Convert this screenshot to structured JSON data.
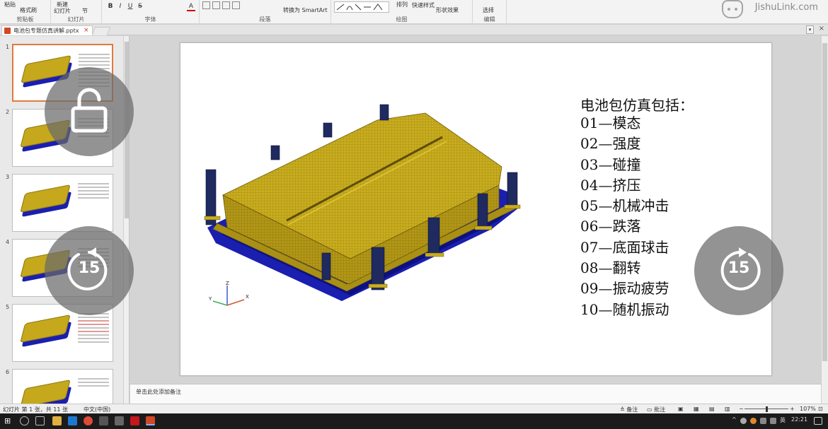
{
  "ribbon": {
    "clipboard": {
      "paste": "粘贴",
      "format_painter": "格式刷",
      "group_label": "剪贴板"
    },
    "slides": {
      "new_slide": "新建",
      "new_slide_sub": "幻灯片",
      "section": "节",
      "group_label": "幻灯片"
    },
    "font": {
      "bold": "B",
      "italic": "I",
      "underline": "U",
      "strike": "S",
      "font_color": "A",
      "group_label": "字体"
    },
    "paragraph": {
      "smartart": "转换为 SmartArt",
      "group_label": "段落"
    },
    "drawing": {
      "arrange": "排列",
      "quick_styles": "快速样式",
      "shape_effects": "形状效果",
      "group_label": "绘图"
    },
    "editing": {
      "select": "选择",
      "group_label": "编辑"
    }
  },
  "watermark": {
    "text": "JishuLink.com"
  },
  "tabs": {
    "doc_tab": "电池包专题仿真讲解.pptx",
    "close_glyph": "×"
  },
  "thumbnails": {
    "numbers": [
      "1",
      "2",
      "3",
      "4",
      "5",
      "6"
    ],
    "selected_index": 0
  },
  "slide": {
    "title": "电池包仿真包括：",
    "items": [
      "01—模态",
      "02—强度",
      "03—碰撞",
      "04—挤压",
      "05—机械冲击",
      "06—跌落",
      "07—底面球击",
      "08—翻转",
      "09—振动疲劳",
      "10—随机振动"
    ],
    "axis": {
      "z": "Z",
      "y": "Y",
      "x": "X"
    }
  },
  "notes": {
    "placeholder": "单击此处添加备注"
  },
  "status": {
    "slide_info": "幻灯片 第 1 张，共 11 张",
    "language": "中文(中国)",
    "notes_btn": "备注",
    "comments_btn": "批注",
    "zoom": "107%"
  },
  "overlays": {
    "skip_back_label": "15",
    "skip_forward_label": "15"
  },
  "taskbar": {
    "ime": "英",
    "clock": "22:21"
  },
  "colors": {
    "pack_top": "#c9ad1e",
    "pack_base": "#1a1fb0",
    "selected_border": "#e07a3f"
  }
}
